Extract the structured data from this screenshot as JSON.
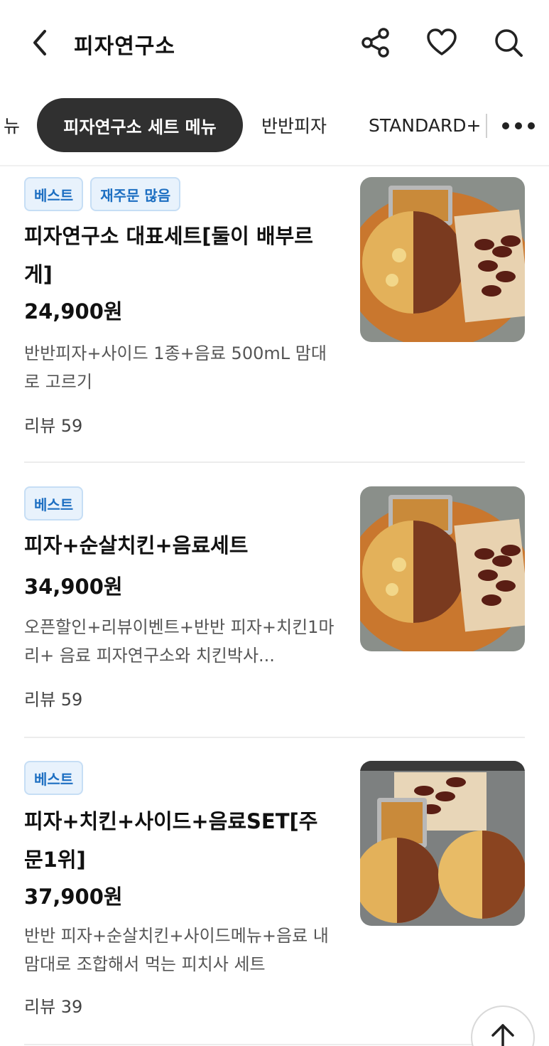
{
  "header": {
    "title": "피자연구소",
    "back_icon": "chevron-left-icon",
    "share_icon": "share-icon",
    "like_icon": "heart-icon",
    "search_icon": "search-icon"
  },
  "tabs": {
    "items": [
      {
        "label": "뉴",
        "active": false
      },
      {
        "label": "피자연구소 세트 메뉴",
        "active": true
      },
      {
        "label": "반반피자",
        "active": false
      },
      {
        "label": "STANDARD+ '",
        "active": false
      }
    ],
    "more_icon": "more-horizontal-icon"
  },
  "menu_items": [
    {
      "badges": [
        "베스트",
        "재주문 많음"
      ],
      "name": "피자연구소 대표세트[둘이 배부르게]",
      "price": "24,900원",
      "description": "반반피자+사이드 1종+음료 500mL 맘대로 고르기",
      "reviews": "리뷰 59"
    },
    {
      "badges": [
        "베스트"
      ],
      "name": "피자+순살치킨+음료세트",
      "price": "34,900원",
      "description": "오픈할인+리뷰이벤트+반반 피자+치킨1마리+ 음료 피자연구소와 치킨박사...",
      "reviews": "리뷰 59"
    },
    {
      "badges": [
        "베스트"
      ],
      "name": "피자+치킨+사이드+음료SET[주문1위]",
      "price": "37,900원",
      "description": "반반 피자+순살치킨+사이드메뉴+음료 내 맘대로 조합해서 먹는 피치사 세트",
      "reviews": "리뷰 39"
    }
  ],
  "scroll_top_icon": "arrow-up-icon",
  "colors": {
    "active_tab_bg": "#303030",
    "badge_bg": "#e8f2fc",
    "badge_text": "#1d6fc2"
  }
}
